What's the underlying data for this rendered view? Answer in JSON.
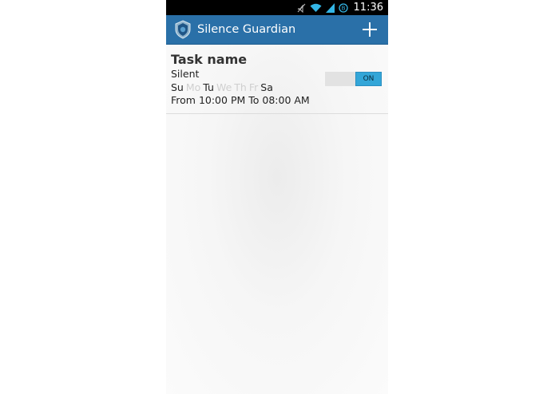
{
  "status_bar": {
    "time": "11:36",
    "icons": [
      "mute-icon",
      "wifi-icon",
      "signal-icon",
      "sync-icon"
    ]
  },
  "action_bar": {
    "title": "Silence Guardian",
    "app_icon": "shield-icon",
    "add_icon": "plus-icon"
  },
  "tasks": [
    {
      "name": "Task name",
      "mode": "Silent",
      "days": [
        {
          "label": "Su",
          "active": true
        },
        {
          "label": "Mo",
          "active": false
        },
        {
          "label": "Tu",
          "active": true
        },
        {
          "label": "We",
          "active": false
        },
        {
          "label": "Th",
          "active": false
        },
        {
          "label": "Fr",
          "active": false
        },
        {
          "label": "Sa",
          "active": true
        }
      ],
      "time": "From 10:00 PM To 08:00 AM",
      "toggle_label": "ON"
    }
  ],
  "colors": {
    "action_bar": "#2a70a8",
    "toggle_on": "#33a6d8",
    "day_inactive": "#cfcfcf"
  }
}
